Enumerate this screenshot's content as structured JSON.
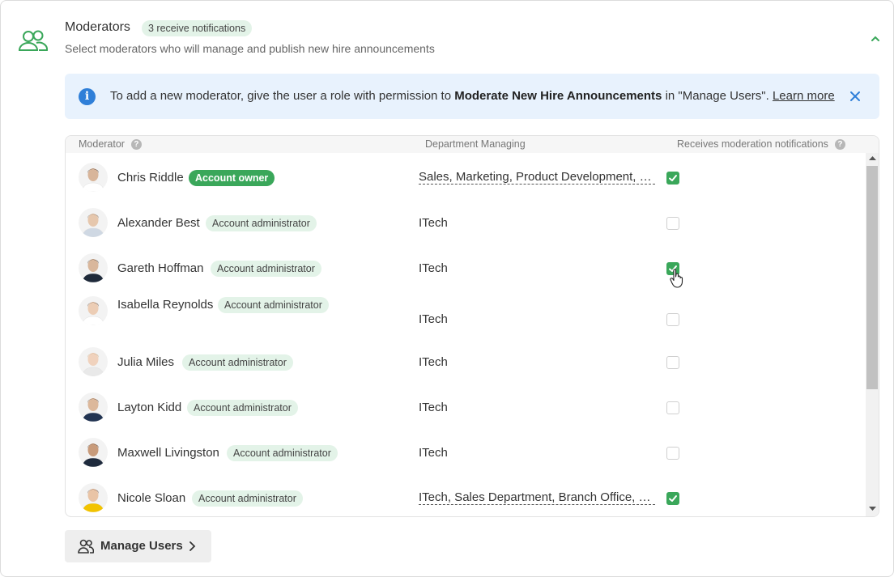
{
  "section": {
    "icon": "users-icon",
    "title": "Moderators",
    "notif_pill": "3 receive notifications",
    "subtitle": "Select moderators who will manage and publish new hire announcements",
    "collapse_icon": "chevron-up-icon"
  },
  "banner": {
    "icon": "info-icon",
    "info_glyph": "i",
    "text_before": "To add a new moderator, give the user a role with permission to ",
    "text_bold": "Moderate New Hire Announcements",
    "text_after": " in \"Manage Users\". ",
    "learn_more": "Learn more",
    "close_icon": "close-icon"
  },
  "table": {
    "headers": {
      "moderator": "Moderator",
      "department": "Department Managing",
      "notifications": "Receives moderation notifications",
      "help_glyph": "?"
    },
    "rows": [
      {
        "name": "Chris Riddle",
        "role": "Account owner",
        "owner": true,
        "dept": "Sales, Marketing, Product Development, S...",
        "notify": true
      },
      {
        "name": "Alexander Best",
        "role": "Account administrator",
        "owner": false,
        "dept": "ITech",
        "notify": false
      },
      {
        "name": "Gareth Hoffman",
        "role": "Account administrator",
        "owner": false,
        "dept": "ITech",
        "notify": true
      },
      {
        "name": "Isabella Reynolds",
        "role": "Account administrator",
        "owner": false,
        "dept": "ITech",
        "notify": false
      },
      {
        "name": "Julia Miles",
        "role": "Account administrator",
        "owner": false,
        "dept": "ITech",
        "notify": false
      },
      {
        "name": "Layton Kidd",
        "role": "Account administrator",
        "owner": false,
        "dept": "ITech",
        "notify": false
      },
      {
        "name": "Maxwell Livingston",
        "role": "Account administrator",
        "owner": false,
        "dept": "ITech",
        "notify": false
      },
      {
        "name": "Nicole Sloan",
        "role": "Account administrator",
        "owner": false,
        "dept": "ITech, Sales Department, Branch Office, Cu...",
        "notify": true
      }
    ]
  },
  "manage_button": {
    "label": "Manage Users",
    "icon": "users-icon",
    "chevron": "chevron-right-icon"
  },
  "colors": {
    "accent_green": "#3aa75a",
    "pill_green_bg": "#e3f3e8",
    "banner_bg": "#e8f2fd",
    "info_blue": "#2f7fd8"
  }
}
